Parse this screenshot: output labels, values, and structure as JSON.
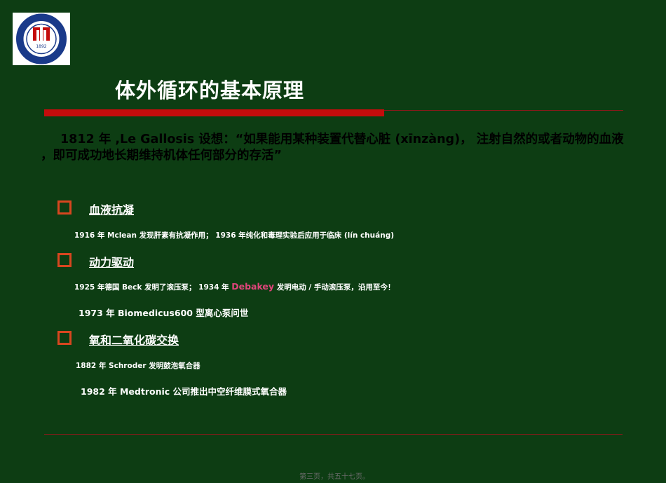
{
  "logo": {
    "icon": "university-hospital-seal-icon",
    "year_text": "1892",
    "brand_color": "#1a3a8a",
    "accent_color": "#c40c0c"
  },
  "title": "体外循环的基本原理",
  "intro": {
    "line1": "1812 年 ,Le Gallosis 设想：“如果能用某种装置代替心脏 (xīnzàng)， 注射自然的或者动物的血液",
    "line2": "，即可成功地长期维持机体任何部分的存活”"
  },
  "sections": [
    {
      "heading": "血液抗凝",
      "items": [
        "1916 年 Mclean 发现肝素有抗凝作用； 1936 年纯化和毒理实验后应用于临床 (lín chuáng)"
      ]
    },
    {
      "heading": "动力驱动",
      "items": [
        {
          "before": "1925 年德国 Beck 发明了滚压泵； 1934 年 ",
          "highlight": "Debakey",
          "after": " 发明电动 / 手动滚压泵，沿用至今！"
        },
        "1973 年 Biomedicus600 型离心泵问世"
      ]
    },
    {
      "heading": "氧和二氧化碳交换",
      "items": [
        "1882 年 Schroder 发明鼓泡氧合器",
        "1982 年 Medtronic 公司推出中空纤维膜式氧合器"
      ]
    }
  ],
  "footer": "第三页，共五十七页。",
  "colors": {
    "background": "#0d3d13",
    "title_rule": "#c40c0c",
    "checkbox_border": "#d8461f",
    "highlight": "#e0457b"
  }
}
